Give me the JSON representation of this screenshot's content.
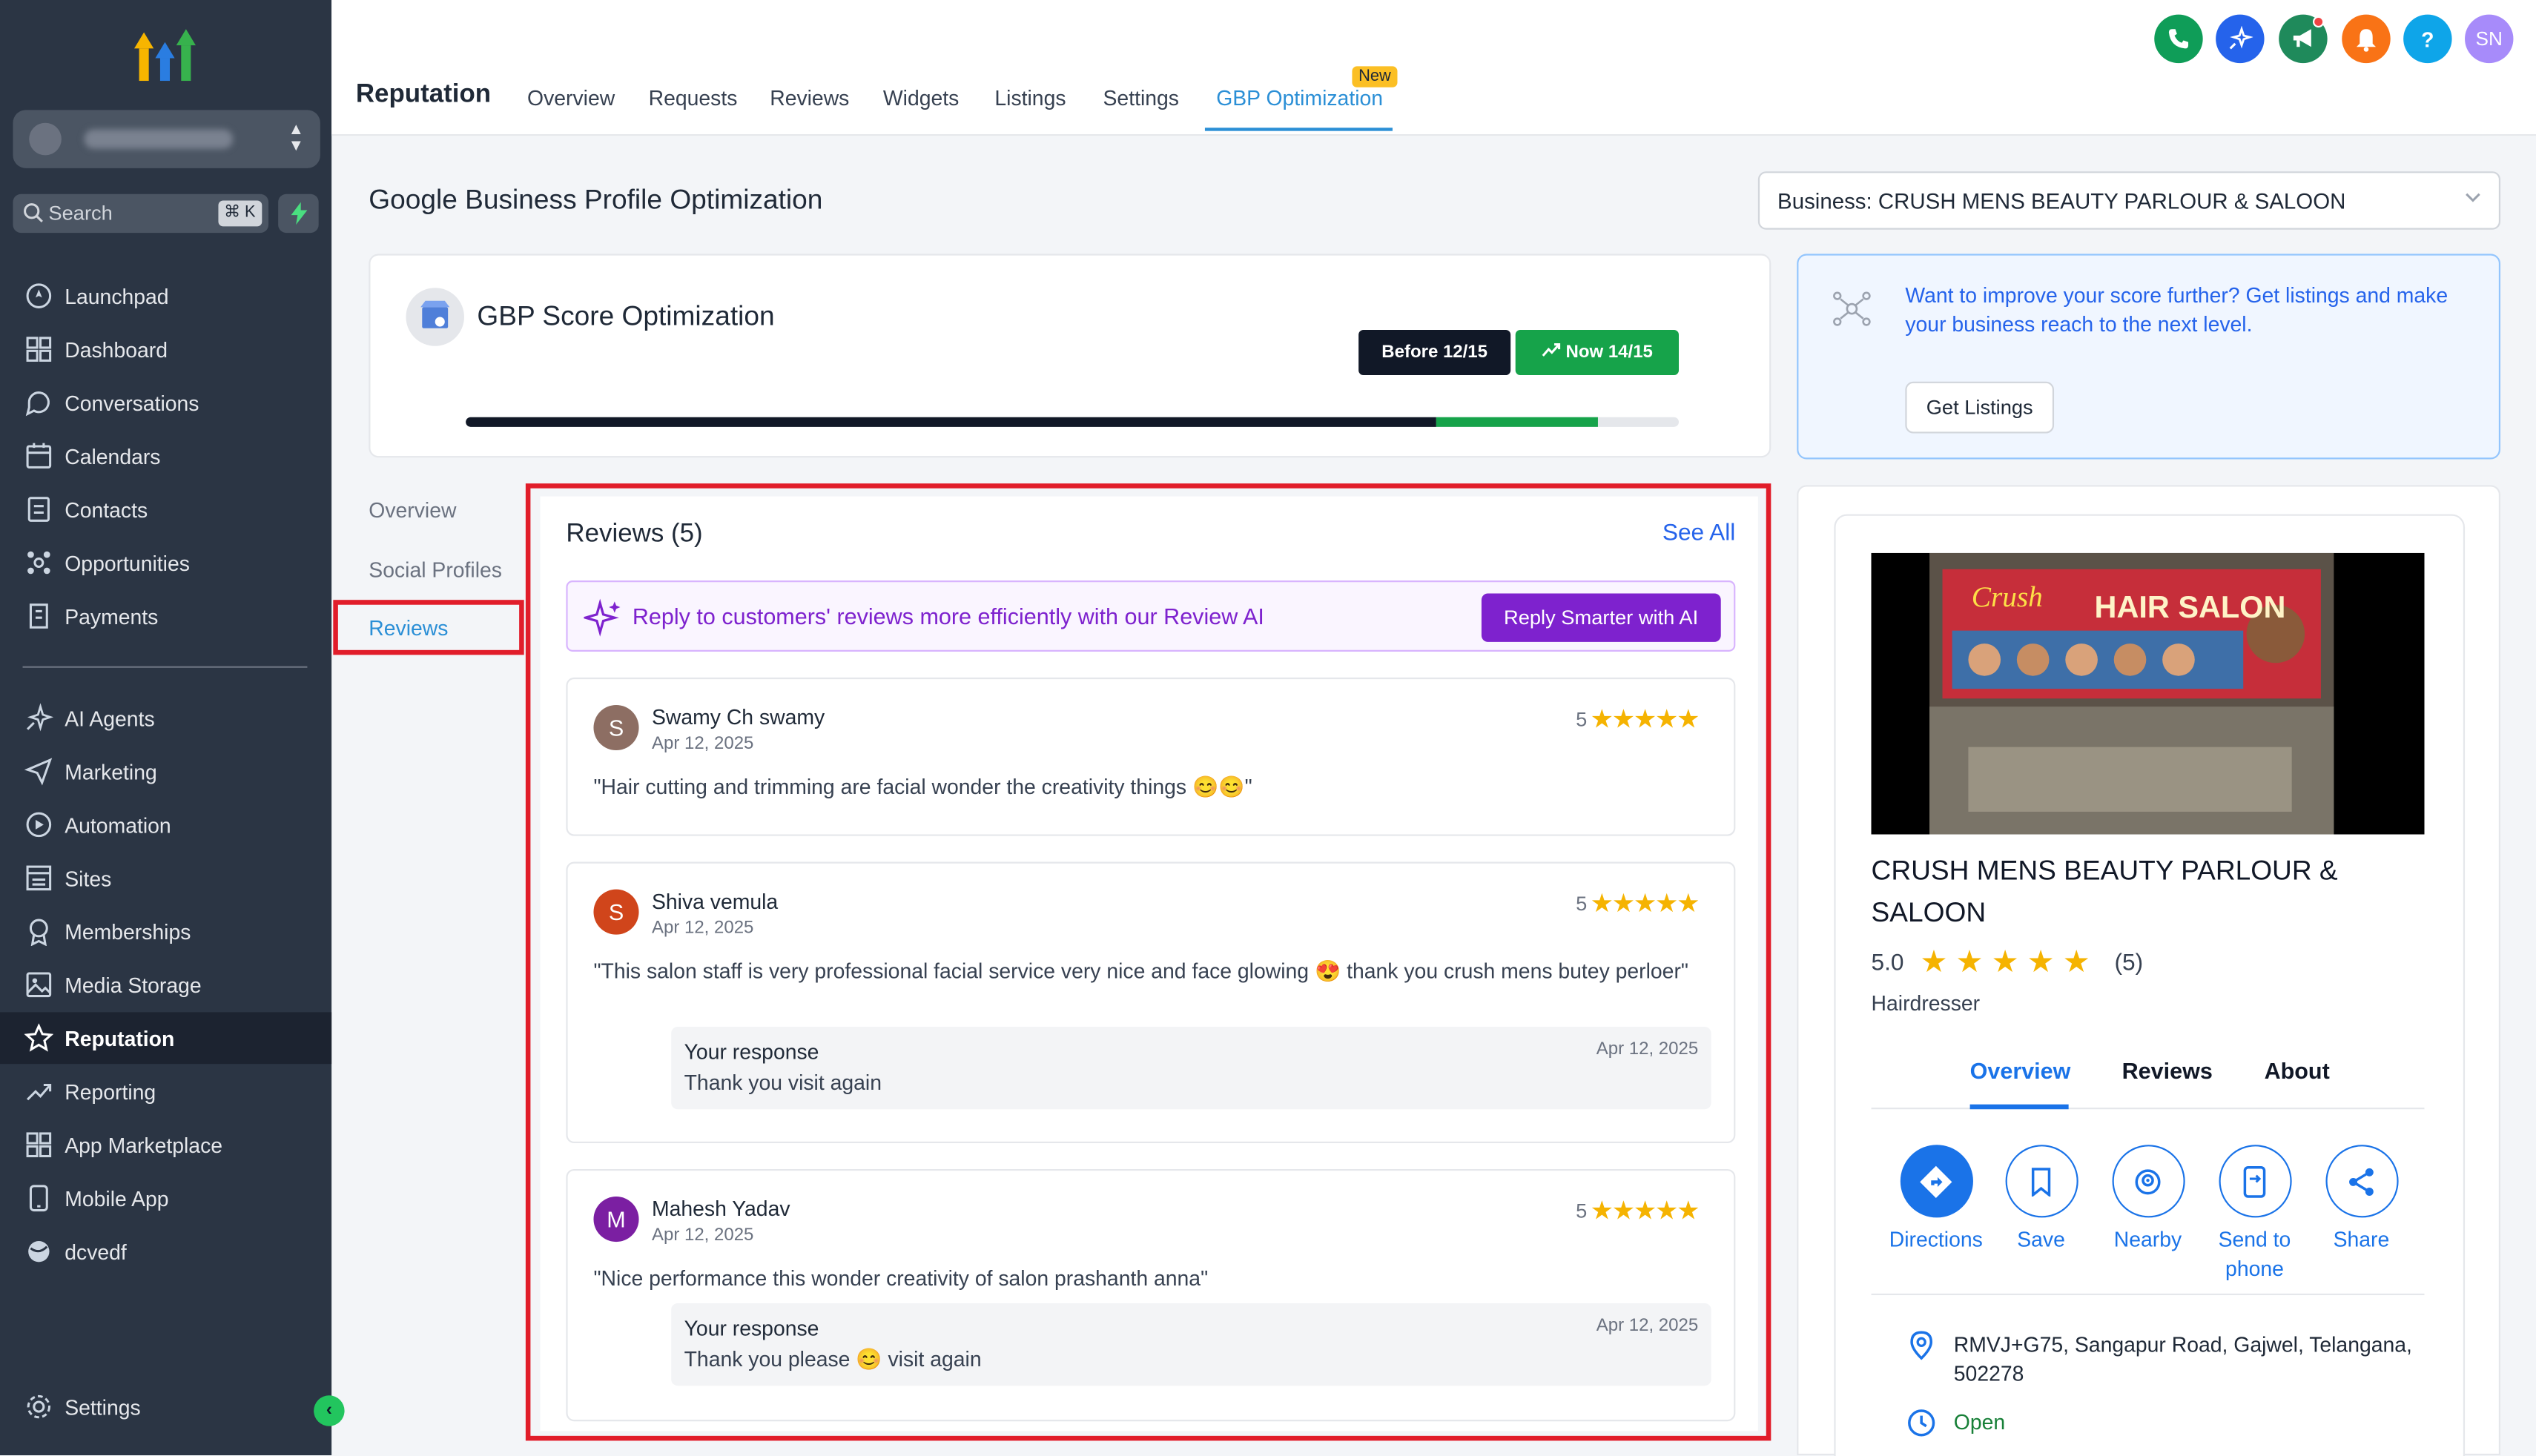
{
  "sidebar": {
    "search_placeholder": "Search",
    "search_shortcut": "⌘ K",
    "items": [
      {
        "label": "Launchpad",
        "icon": "rocket-icon"
      },
      {
        "label": "Dashboard",
        "icon": "grid-icon"
      },
      {
        "label": "Conversations",
        "icon": "chat-icon"
      },
      {
        "label": "Calendars",
        "icon": "calendar-icon"
      },
      {
        "label": "Contacts",
        "icon": "contacts-icon"
      },
      {
        "label": "Opportunities",
        "icon": "pipeline-icon"
      },
      {
        "label": "Payments",
        "icon": "receipt-icon"
      },
      {
        "label": "AI Agents",
        "icon": "sparkle-icon"
      },
      {
        "label": "Marketing",
        "icon": "send-icon"
      },
      {
        "label": "Automation",
        "icon": "automation-icon"
      },
      {
        "label": "Sites",
        "icon": "sites-icon"
      },
      {
        "label": "Memberships",
        "icon": "badge-icon"
      },
      {
        "label": "Media Storage",
        "icon": "image-icon"
      },
      {
        "label": "Reputation",
        "icon": "star-icon"
      },
      {
        "label": "Reporting",
        "icon": "trend-icon"
      },
      {
        "label": "App Marketplace",
        "icon": "apps-icon"
      },
      {
        "label": "Mobile App",
        "icon": "phone-icon"
      },
      {
        "label": "dcvedf",
        "icon": "globe-icon"
      }
    ],
    "settings_label": "Settings"
  },
  "header": {
    "title": "Reputation",
    "tabs": [
      "Overview",
      "Requests",
      "Reviews",
      "Widgets",
      "Listings",
      "Settings",
      "GBP Optimization"
    ],
    "new_badge": "New",
    "avatar_initials": "SN",
    "help_label": "?"
  },
  "page": {
    "title": "Google Business Profile Optimization",
    "business_select": "Business: CRUSH MENS BEAUTY PARLOUR & SALOON"
  },
  "score": {
    "title": "GBP Score Optimization",
    "before_label": "Before 12/15",
    "now_label": "Now 14/15",
    "before": 12,
    "now": 14,
    "max": 15
  },
  "promo": {
    "text": "Want to improve your score further? Get listings and make your business reach to the next level.",
    "button": "Get Listings"
  },
  "subnav": [
    "Overview",
    "Social Profiles",
    "Reviews"
  ],
  "reviews": {
    "title": "Reviews (5)",
    "see_all": "See All",
    "ai_banner": "Reply to customers' reviews more efficiently with our Review AI",
    "ai_button": "Reply Smarter with AI",
    "response_label": "Your response",
    "items": [
      {
        "initial": "S",
        "color": "#8d6e63",
        "name": "Swamy Ch swamy",
        "date": "Apr 12, 2025",
        "rating": "5",
        "text": "\"Hair cutting and trimming are facial wonder the creativity things 😊😊\""
      },
      {
        "initial": "S",
        "color": "#d0451b",
        "name": "Shiva vemula",
        "date": "Apr 12, 2025",
        "rating": "5",
        "text": "\"This salon staff is very professional facial service very nice and face glowing 😍 thank you crush mens butey perloer\"",
        "response_date": "Apr 12, 2025",
        "response": "Thank you visit again"
      },
      {
        "initial": "M",
        "color": "#7b1fa2",
        "name": "Mahesh Yadav",
        "date": "Apr 12, 2025",
        "rating": "5",
        "text": "\"Nice performance this wonder creativity of salon prashanth anna\"",
        "response_date": "Apr 12, 2025",
        "response": "Thank you please 😊 visit again"
      }
    ]
  },
  "gbp": {
    "photo_sign": "HAIR SALON",
    "name": "CRUSH MENS BEAUTY PARLOUR & SALOON",
    "rating": "5.0",
    "count": "(5)",
    "category": "Hairdresser",
    "tabs": [
      "Overview",
      "Reviews",
      "About"
    ],
    "actions": [
      "Directions",
      "Save",
      "Nearby",
      "Send to phone",
      "Share"
    ],
    "address": "RMVJ+G75, Sangapur Road, Gajwel, Telangana, 502278",
    "status": "Open"
  },
  "colors": {
    "sidebar_bg": "#2b3544",
    "accent_blue": "#2b8fd6",
    "google_blue": "#1a73e8",
    "success_green": "#16a34a",
    "ai_purple": "#7e22ce",
    "highlight_red": "#e11d2a"
  }
}
